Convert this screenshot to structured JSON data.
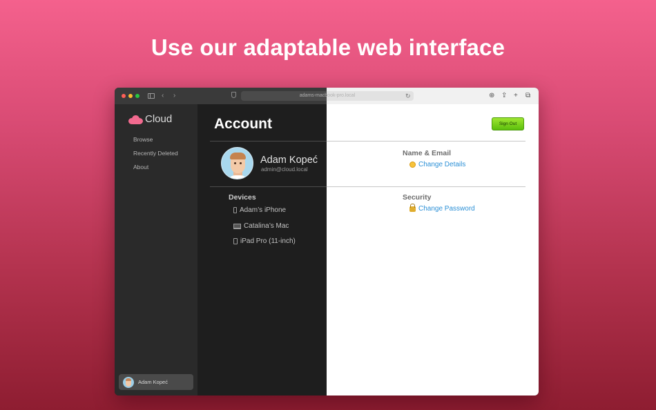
{
  "headline": "Use our adaptable web interface",
  "browser": {
    "url": "adams-macbook-pro.local"
  },
  "sidebar": {
    "logo_text": "Cloud",
    "items": [
      {
        "label": "Browse"
      },
      {
        "label": "Recently Deleted"
      },
      {
        "label": "About"
      }
    ],
    "user_name": "Adam Kopeć"
  },
  "account": {
    "title": "Account",
    "sign_out_label": "Sign Out",
    "name": "Adam Kopeć",
    "email": "admin@cloud.local",
    "devices_heading": "Devices",
    "devices": [
      {
        "label": "Adam’s iPhone",
        "icon": "phone-icon"
      },
      {
        "label": "Catalina’s Mac",
        "icon": "mac-icon"
      },
      {
        "label": "iPad Pro (11-inch)",
        "icon": "ipad-icon"
      }
    ],
    "name_email_heading": "Name & Email",
    "change_details_label": "Change Details",
    "security_heading": "Security",
    "change_password_label": "Change Password"
  },
  "colors": {
    "accent_link": "#2a8fd6",
    "sign_out_button": "#7fd41e",
    "brand_pink": "#f26a8f"
  }
}
